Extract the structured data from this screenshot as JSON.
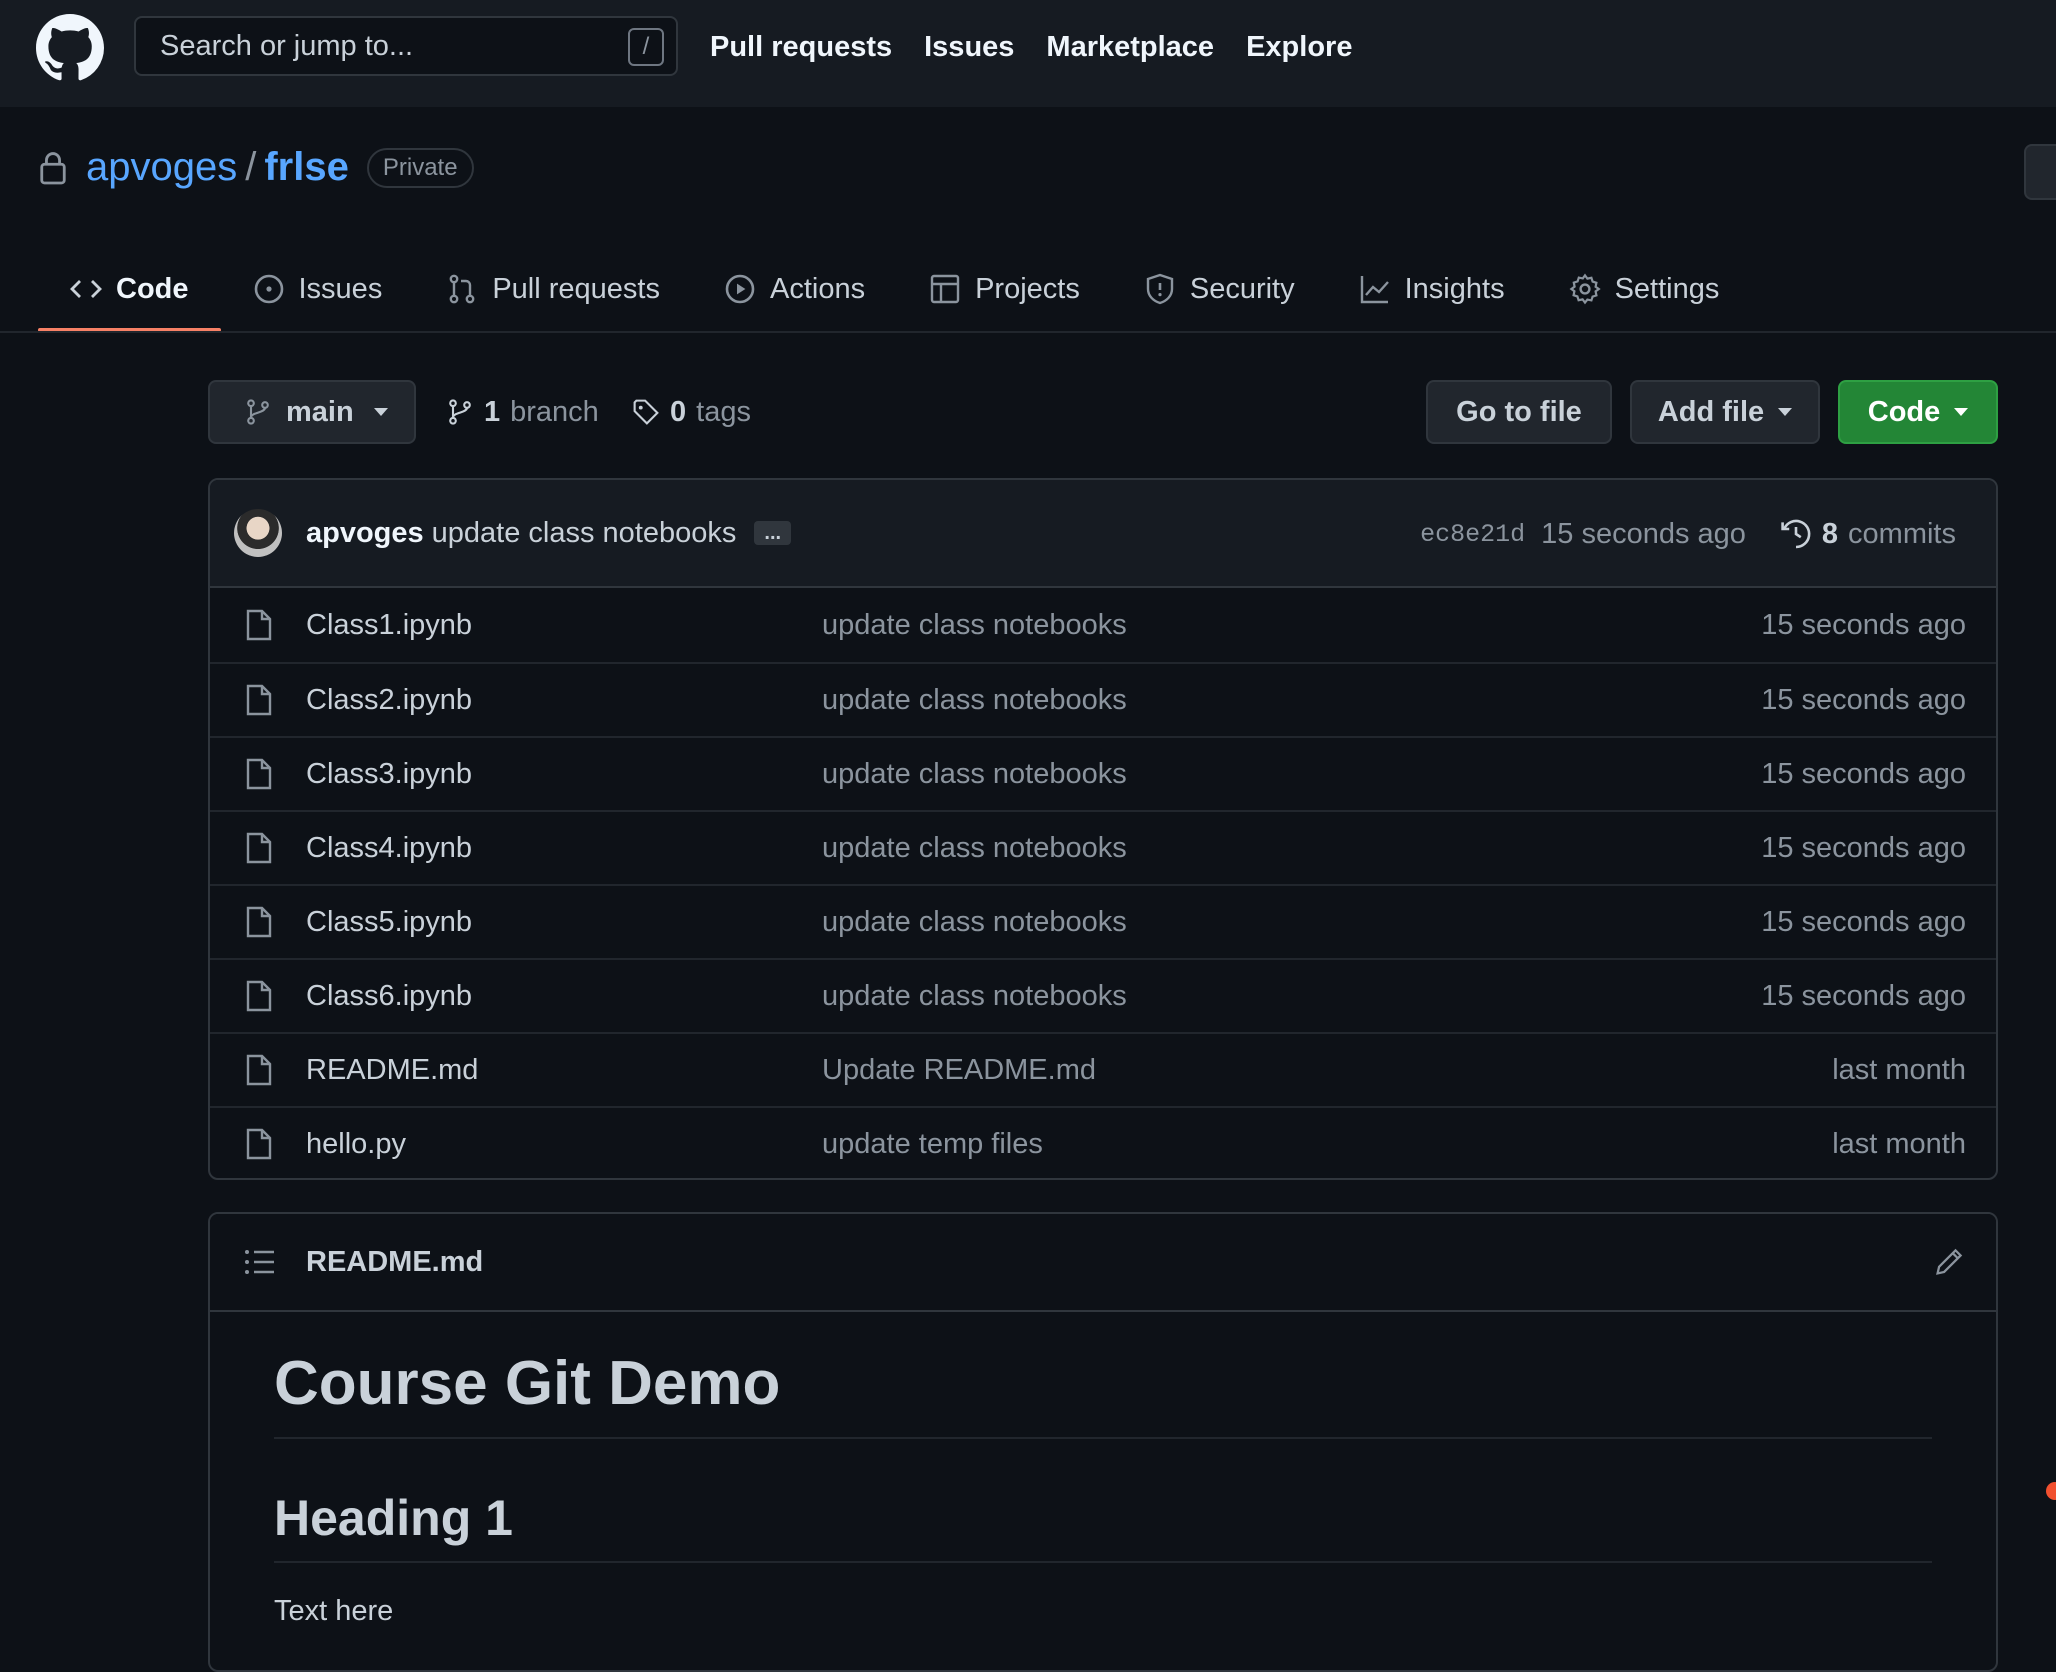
{
  "header": {
    "search_placeholder": "Search or jump to...",
    "slash_key": "/",
    "nav": [
      "Pull requests",
      "Issues",
      "Marketplace",
      "Explore"
    ]
  },
  "repo": {
    "owner": "apvoges",
    "separator": "/",
    "name": "frlse",
    "visibility": "Private"
  },
  "tabs": [
    {
      "label": "Code",
      "icon": "code-icon",
      "active": true
    },
    {
      "label": "Issues",
      "icon": "issue-icon"
    },
    {
      "label": "Pull requests",
      "icon": "pull-request-icon"
    },
    {
      "label": "Actions",
      "icon": "play-icon"
    },
    {
      "label": "Projects",
      "icon": "table-icon"
    },
    {
      "label": "Security",
      "icon": "shield-icon"
    },
    {
      "label": "Insights",
      "icon": "graph-icon"
    },
    {
      "label": "Settings",
      "icon": "gear-icon"
    }
  ],
  "branch_bar": {
    "branch": "main",
    "branch_count": "1",
    "branch_label": "branch",
    "tag_count": "0",
    "tag_label": "tags",
    "go_to_file": "Go to file",
    "add_file": "Add file",
    "code": "Code"
  },
  "latest_commit": {
    "author": "apvoges",
    "message": "update class notebooks",
    "ellipsis": "...",
    "sha": "ec8e21d",
    "age": "15 seconds ago",
    "commit_count": "8",
    "commit_label": "commits"
  },
  "files": [
    {
      "name": "Class1.ipynb",
      "message": "update class notebooks",
      "age": "15 seconds ago"
    },
    {
      "name": "Class2.ipynb",
      "message": "update class notebooks",
      "age": "15 seconds ago"
    },
    {
      "name": "Class3.ipynb",
      "message": "update class notebooks",
      "age": "15 seconds ago"
    },
    {
      "name": "Class4.ipynb",
      "message": "update class notebooks",
      "age": "15 seconds ago"
    },
    {
      "name": "Class5.ipynb",
      "message": "update class notebooks",
      "age": "15 seconds ago"
    },
    {
      "name": "Class6.ipynb",
      "message": "update class notebooks",
      "age": "15 seconds ago"
    },
    {
      "name": "README.md",
      "message": "Update README.md",
      "age": "last month"
    },
    {
      "name": "hello.py",
      "message": "update temp files",
      "age": "last month"
    }
  ],
  "readme": {
    "filename": "README.md",
    "h1": "Course Git Demo",
    "h2": "Heading 1",
    "text": "Text here"
  },
  "colors": {
    "accent_tab": "#f78166",
    "link": "#58a6ff",
    "green_button": "#238636",
    "language_dot": "#f1502f"
  }
}
